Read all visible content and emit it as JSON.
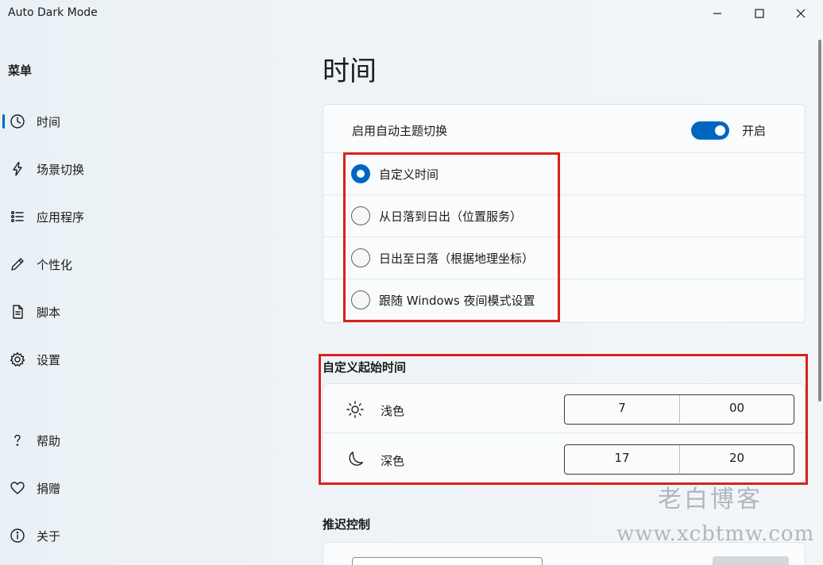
{
  "window": {
    "title": "Auto Dark Mode",
    "controls": {
      "minimize": "minimize",
      "maximize": "maximize",
      "close": "close"
    }
  },
  "sidebar": {
    "heading": "菜单",
    "items": [
      {
        "label": "时间",
        "icon": "clock-icon",
        "active": true
      },
      {
        "label": "场景切换",
        "icon": "lightning-icon"
      },
      {
        "label": "应用程序",
        "icon": "list-icon"
      },
      {
        "label": "个性化",
        "icon": "pen-icon"
      },
      {
        "label": "脚本",
        "icon": "document-icon"
      },
      {
        "label": "设置",
        "icon": "gear-icon"
      },
      {
        "label": "帮助",
        "icon": "question-icon"
      },
      {
        "label": "捐赠",
        "icon": "heart-icon"
      },
      {
        "label": "关于",
        "icon": "info-icon"
      }
    ]
  },
  "main": {
    "title": "时间",
    "auto_switch": {
      "label": "启用自动主题切换",
      "state": "开启",
      "enabled": true
    },
    "modes": [
      {
        "label": "自定义时间",
        "selected": true
      },
      {
        "label": "从日落到日出（位置服务）",
        "selected": false
      },
      {
        "label": "日出至日落（根据地理坐标）",
        "selected": false
      },
      {
        "label": "跟随 Windows 夜间模式设置",
        "selected": false
      }
    ],
    "custom_start": {
      "title": "自定义起始时间",
      "light": {
        "label": "浅色",
        "icon": "sun-icon",
        "hour": "7",
        "minute": "00"
      },
      "dark": {
        "label": "深色",
        "icon": "moon-icon",
        "hour": "17",
        "minute": "20"
      }
    },
    "postpone": {
      "title": "推迟控制"
    }
  },
  "watermark": {
    "line1": "老白博客",
    "line2": "www.xcbtmw.com"
  },
  "colors": {
    "accent": "#0067c0",
    "highlight": "#d9211c"
  }
}
